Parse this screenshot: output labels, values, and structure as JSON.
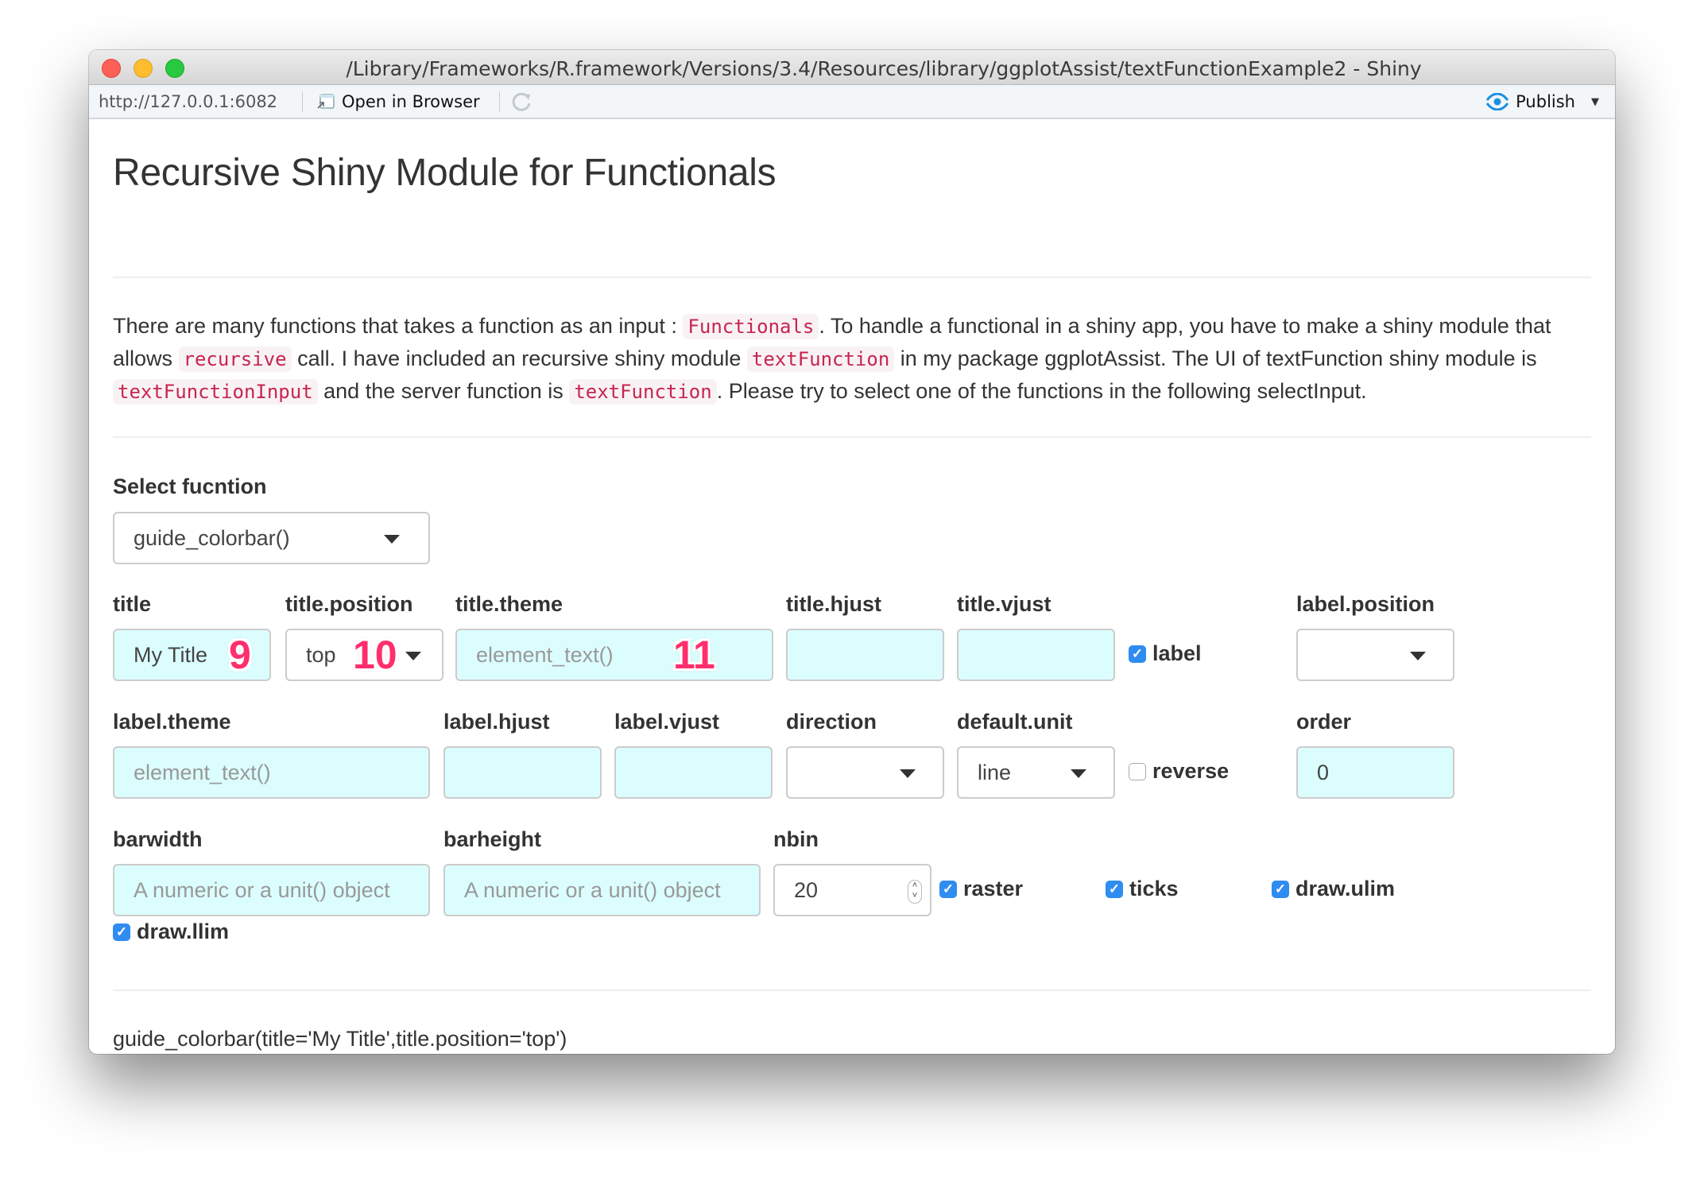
{
  "window": {
    "title": "/Library/Frameworks/R.framework/Versions/3.4/Resources/library/ggplotAssist/textFunctionExample2 - Shiny"
  },
  "toolbar": {
    "url": "http://127.0.0.1:6082",
    "open_in_browser_label": "Open in Browser",
    "publish_label": "Publish",
    "accent_color": "#1a8fe3"
  },
  "page": {
    "heading": "Recursive Shiny Module for Functionals",
    "paragraph": [
      {
        "type": "text",
        "value": "There are many functions that takes a function as an input : "
      },
      {
        "type": "code",
        "value": "Functionals"
      },
      {
        "type": "text",
        "value": ". To handle a functional in a shiny app, you have to make a shiny module that allows "
      },
      {
        "type": "code",
        "value": "recursive"
      },
      {
        "type": "text",
        "value": " call. I have included an recursive shiny module "
      },
      {
        "type": "code",
        "value": "textFunction"
      },
      {
        "type": "text",
        "value": " in my package ggplotAssist. The UI of textFunction shiny module is "
      },
      {
        "type": "code",
        "value": "textFunctionInput"
      },
      {
        "type": "text",
        "value": " and the server function is "
      },
      {
        "type": "code",
        "value": "textFunction"
      },
      {
        "type": "text",
        "value": ". Please try to select one of the functions in the following selectInput."
      }
    ]
  },
  "select_function": {
    "label": "Select fucntion",
    "value": "guide_colorbar()"
  },
  "fields": {
    "title": {
      "label": "title",
      "value": "My Title",
      "badge": "9"
    },
    "title_position": {
      "label": "title.position",
      "value": "top",
      "badge": "10"
    },
    "title_theme": {
      "label": "title.theme",
      "placeholder": "element_text()",
      "badge": "11"
    },
    "title_hjust": {
      "label": "title.hjust",
      "value": ""
    },
    "title_vjust": {
      "label": "title.vjust",
      "value": ""
    },
    "label": {
      "label": "label",
      "checked": true
    },
    "label_position": {
      "label": "label.position",
      "value": ""
    },
    "label_theme": {
      "label": "label.theme",
      "placeholder": "element_text()"
    },
    "label_hjust": {
      "label": "label.hjust",
      "value": ""
    },
    "label_vjust": {
      "label": "label.vjust",
      "value": ""
    },
    "direction": {
      "label": "direction",
      "value": ""
    },
    "default_unit": {
      "label": "default.unit",
      "value": "line"
    },
    "reverse": {
      "label": "reverse",
      "checked": false
    },
    "order": {
      "label": "order",
      "value": "0"
    },
    "barwidth": {
      "label": "barwidth",
      "placeholder": "A numeric or a unit() object"
    },
    "barheight": {
      "label": "barheight",
      "placeholder": "A numeric or a unit() object"
    },
    "nbin": {
      "label": "nbin",
      "value": "20"
    },
    "raster": {
      "label": "raster",
      "checked": true
    },
    "ticks": {
      "label": "ticks",
      "checked": true
    },
    "draw_ulim": {
      "label": "draw.ulim",
      "checked": true
    },
    "draw_llim": {
      "label": "draw.llim",
      "checked": true
    }
  },
  "output": {
    "code": "guide_colorbar(title='My Title',title.position='top')"
  }
}
